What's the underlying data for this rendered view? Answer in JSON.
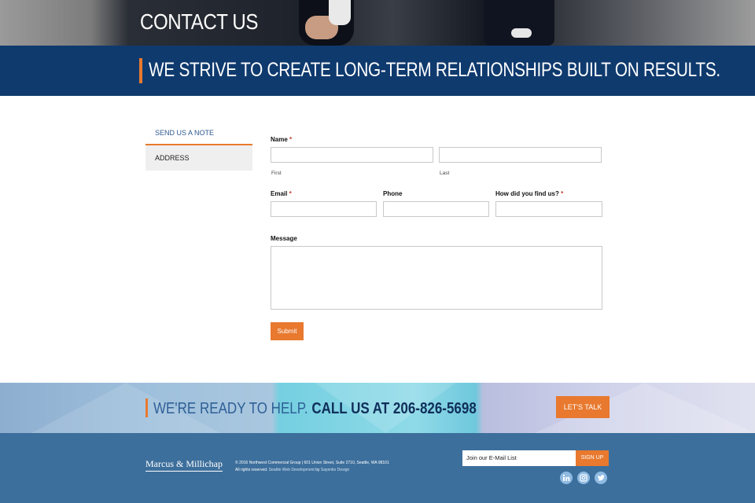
{
  "hero": {
    "title": "CONTACT US"
  },
  "tagline": {
    "text": "WE STRIVE TO CREATE LONG-TERM RELATIONSHIPS BUILT ON RESULTS."
  },
  "sidebar": {
    "tabs": [
      {
        "label": "SEND US A NOTE",
        "active": true
      },
      {
        "label": "ADDRESS",
        "active": false
      }
    ]
  },
  "form": {
    "name_label": "Name",
    "required_mark": "*",
    "first_label": "First",
    "last_label": "Last",
    "email_label": "Email",
    "phone_label": "Phone",
    "how_label": "How did you find us?",
    "message_label": "Message",
    "submit_label": "Submit"
  },
  "cta": {
    "lead": "WE'RE READY TO HELP.",
    "call": "CALL US AT 206-826-5698",
    "button": "LET'S TALK"
  },
  "footer": {
    "logo": "Marcus & Millichap",
    "copyright": "© 2016 Northwest Commercial Group | 601 Union Street, Suite 2710, Seattle, WA 98101",
    "rights": "All rights reserved.",
    "dev_link": "Seattle Web Development",
    "by": "by",
    "design_link": "Sayenko Design",
    "newsletter_placeholder": "Join our E-Mail List",
    "signup_label": "SIGN UP",
    "social": [
      "linkedin-icon",
      "instagram-icon",
      "twitter-icon"
    ]
  },
  "colors": {
    "accent": "#e8792e",
    "navy": "#0f3a6e",
    "footer": "#3d6f9c",
    "link": "#2e5a8e"
  }
}
